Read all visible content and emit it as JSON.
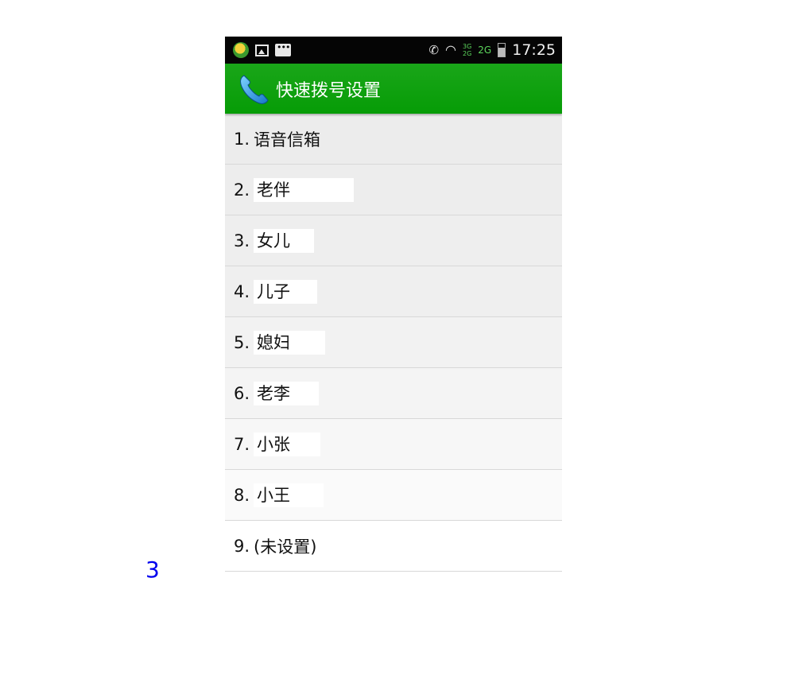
{
  "status_bar": {
    "time": "17:25",
    "network_top": "3G",
    "network_bottom": "2G",
    "network_second": "2G",
    "icons": [
      "app-notification-icon",
      "image-icon",
      "message-icon",
      "nfc-icon",
      "wifi-icon",
      "signal-icon",
      "battery-icon"
    ]
  },
  "action_bar": {
    "title": "快速拨号设置",
    "icon": "phone-icon",
    "accent_color": "#069c06"
  },
  "speed_dial": {
    "items": [
      {
        "number": "1.",
        "name": "语音信箱"
      },
      {
        "number": "2.",
        "name": "老伴"
      },
      {
        "number": "3.",
        "name": "女儿"
      },
      {
        "number": "4.",
        "name": "儿子"
      },
      {
        "number": "5.",
        "name": "媳妇"
      },
      {
        "number": "6.",
        "name": "老李"
      },
      {
        "number": "7.",
        "name": "小张"
      },
      {
        "number": "8.",
        "name": "小王"
      },
      {
        "number": "9.",
        "name": "(未设置)"
      }
    ]
  },
  "page_marker": "3"
}
